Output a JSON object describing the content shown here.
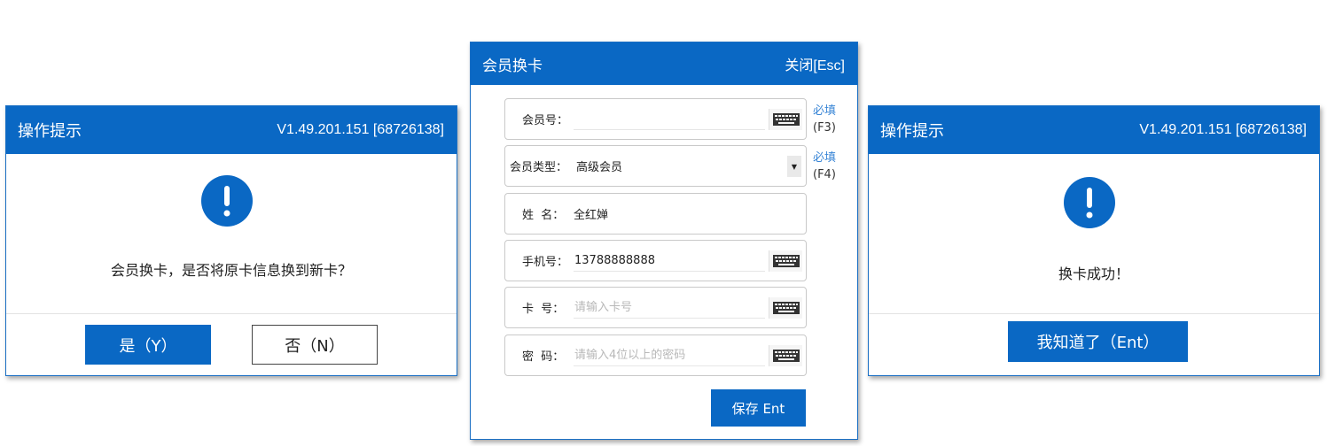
{
  "confirm_dialog": {
    "title": "操作提示",
    "version": "V1.49.201.151 [68726138]",
    "message": "会员换卡，是否将原卡信息换到新卡？",
    "yes_label": "是（Y）",
    "no_label": "否（N）"
  },
  "card_change_form": {
    "title": "会员换卡",
    "close_label": "关闭[Esc]",
    "fields": {
      "member_no": {
        "label": "会员号：",
        "value": "",
        "placeholder": "",
        "required": "必填",
        "shortcut": "(F3)"
      },
      "member_type": {
        "label": "会员类型：",
        "value": "高级会员",
        "required": "必填",
        "shortcut": "(F4)"
      },
      "name": {
        "label": "姓  名：",
        "value": "全红婵"
      },
      "phone": {
        "label": "手机号：",
        "value": "13788888888",
        "placeholder": ""
      },
      "card_no": {
        "label": "卡  号：",
        "value": "",
        "placeholder": "请输入卡号"
      },
      "password": {
        "label": "密  码：",
        "value": "",
        "placeholder": "请输入4位以上的密码"
      }
    },
    "save_label": "保存 Ent"
  },
  "success_dialog": {
    "title": "操作提示",
    "version": "V1.49.201.151 [68726138]",
    "message": "换卡成功！",
    "ok_label": "我知道了（Ent）"
  },
  "colors": {
    "primary": "#0a68c4",
    "required_text": "#3a86d6"
  },
  "icons": [
    "alert-icon",
    "keyboard-icon",
    "dropdown-arrow-icon"
  ]
}
